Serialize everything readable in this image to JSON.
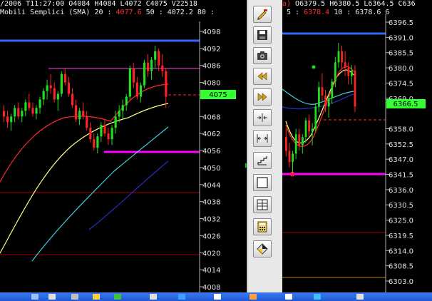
{
  "left_chart": {
    "header": {
      "line1": {
        "date": "/2006",
        "time": "T11:27:00",
        "open": "O4084",
        "high": "H4084",
        "low": "L4072",
        "close": "C4075",
        "volume": "V22518"
      },
      "line2": {
        "indicator": "Mobili Semplici (SMA)",
        "p1": "20 :",
        "v1": "4077.6",
        "p2": "50 :",
        "v2": "4072.2",
        "p3": "80 :"
      }
    },
    "price_axis_labels": [
      "4098",
      "4092",
      "4086",
      "4080",
      "4068",
      "4062",
      "4056",
      "4050",
      "4044",
      "4038",
      "4032",
      "4026",
      "4020",
      "4014",
      "4008"
    ],
    "current_price_label": "4075"
  },
  "right_chart": {
    "header": {
      "line1": {
        "prefix": "a)",
        "open": "O6379.5",
        "high": "H6380.5",
        "low": "L6364.5",
        "close": "C636"
      },
      "line2": {
        "p1": "5 :",
        "v1": "6378.4",
        "p2": "10 :",
        "v2": "6378.6",
        "p3": "6"
      }
    },
    "price_axis_labels": [
      "6396.5",
      "6391.0",
      "6385.5",
      "6380.0",
      "6374.5",
      "6369.0",
      "6358.0",
      "6352.5",
      "6347.0",
      "6341.5",
      "6336.0",
      "6330.5",
      "6325.0",
      "6319.5",
      "6314.0",
      "6308.5",
      "6303.0"
    ],
    "current_price_label": "6366.5"
  },
  "colors": {
    "up": "#22dd22",
    "down": "#ff2222",
    "background": "#000000",
    "price_tag": "#33ff33",
    "blue_line": "#3366ff",
    "magenta_line": "#ff00ff",
    "dark_red_line": "#aa0000",
    "sma_fast": "#ff2a2a",
    "sma_mid": "#ffff80",
    "sma_slow_cyan": "#40d0e0",
    "sma_slower_blue": "#2030c0",
    "taskbar": "#2a63e0"
  },
  "toolbar": {
    "buttons": [
      "pencil-icon",
      "save-icon",
      "camera-icon",
      "rewind-icon",
      "fast-forward-icon",
      "compress-horizontal-icon",
      "expand-horizontal-icon",
      "staircase-icon",
      "blank-window-icon",
      "grid-icon",
      "calculator-icon",
      "palette-icon"
    ]
  }
}
